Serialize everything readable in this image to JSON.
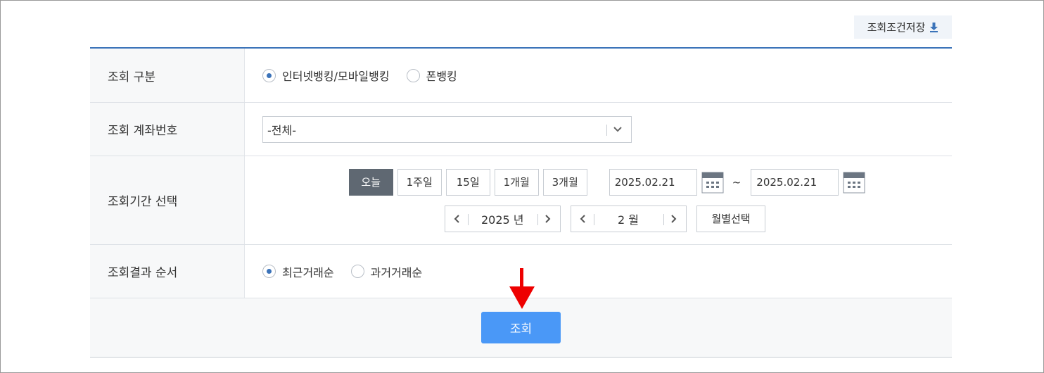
{
  "toolbar": {
    "save_condition_label": "조회조건저장",
    "save_icon": "download-icon"
  },
  "form": {
    "type_label": "조회 구분",
    "type_options": [
      {
        "label": "인터넷뱅킹/모바일뱅킹",
        "selected": true
      },
      {
        "label": "폰뱅킹",
        "selected": false
      }
    ],
    "account_label": "조회 계좌번호",
    "account_value": "-전체-",
    "period_label": "조회기간 선택",
    "period_buttons": [
      {
        "label": "오늘",
        "active": true
      },
      {
        "label": "1주일",
        "active": false
      },
      {
        "label": "15일",
        "active": false
      },
      {
        "label": "1개월",
        "active": false
      },
      {
        "label": "3개월",
        "active": false
      }
    ],
    "start_date": "2025.02.21",
    "range_separator": "~",
    "end_date": "2025.02.21",
    "year_value": "2025 년",
    "month_value": "2 월",
    "month_select_label": "월별선택",
    "order_label": "조회결과 순서",
    "order_options": [
      {
        "label": "최근거래순",
        "selected": true
      },
      {
        "label": "과거거래순",
        "selected": false
      }
    ]
  },
  "submit_label": "조회",
  "colors": {
    "accent": "#3b73b9",
    "submit": "#4a98f7",
    "active_button": "#5f6872",
    "annotation_arrow": "#ee0000"
  }
}
